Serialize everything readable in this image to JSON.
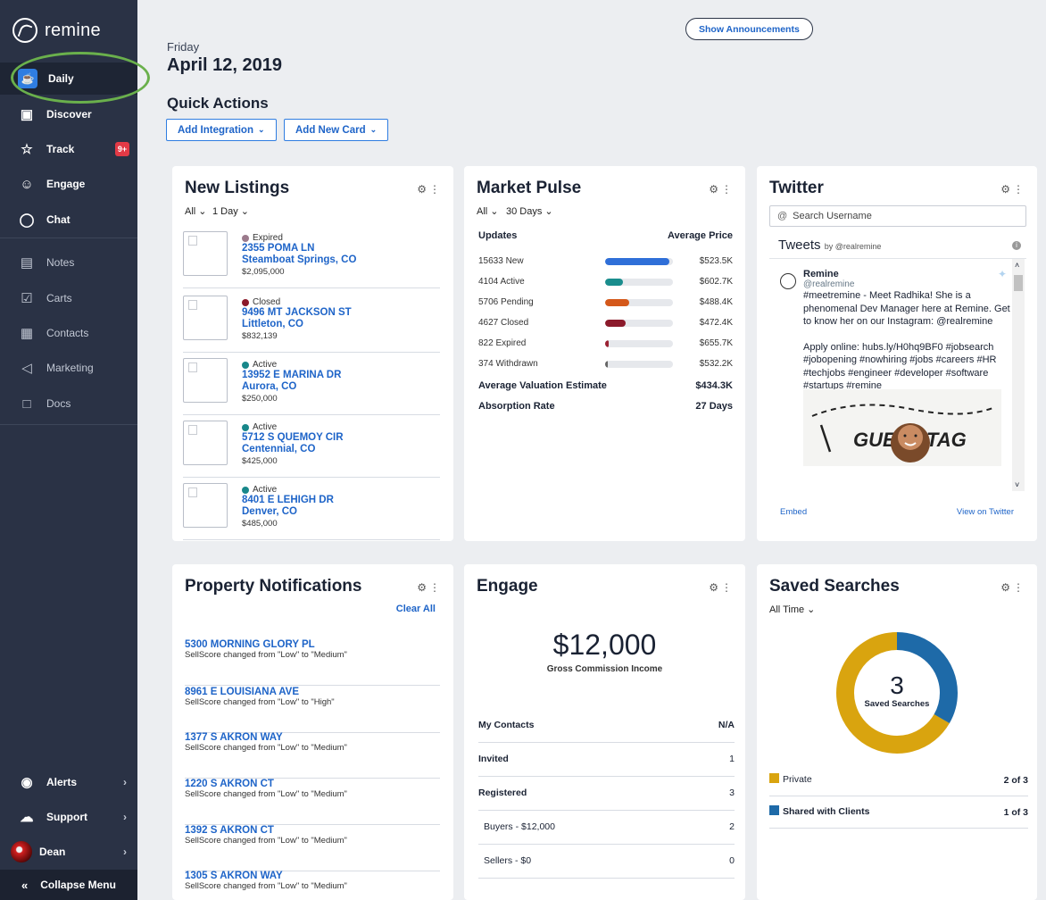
{
  "brand": {
    "name": "remine"
  },
  "sidebar": {
    "items": [
      {
        "label": "Daily",
        "icon": "daily-icon"
      },
      {
        "label": "Discover",
        "icon": "map-icon"
      },
      {
        "label": "Track",
        "icon": "star-icon",
        "badge": "9+"
      },
      {
        "label": "Engage",
        "icon": "users-icon"
      },
      {
        "label": "Chat",
        "icon": "chat-icon"
      },
      {
        "label": "Notes",
        "icon": "notes-icon"
      },
      {
        "label": "Carts",
        "icon": "cart-icon"
      },
      {
        "label": "Contacts",
        "icon": "contacts-icon"
      },
      {
        "label": "Marketing",
        "icon": "megaphone-icon"
      },
      {
        "label": "Docs",
        "icon": "doc-icon"
      }
    ],
    "bottom": [
      {
        "label": "Alerts",
        "icon": "bell-icon"
      },
      {
        "label": "Support",
        "icon": "headset-icon"
      },
      {
        "label": "Dean",
        "icon": "avatar"
      }
    ],
    "collapse_label": "Collapse Menu"
  },
  "header": {
    "announcements_label": "Show Announcements",
    "day": "Friday",
    "date": "April 12, 2019",
    "quick_actions_title": "Quick Actions",
    "add_integration": "Add Integration",
    "add_card": "Add New Card"
  },
  "new_listings": {
    "title": "New Listings",
    "filter_all": "All",
    "filter_range": "1 Day",
    "items": [
      {
        "status": "Expired",
        "status_color": "#9b7a8c",
        "address": "2355 POMA LN",
        "city": "Steamboat Springs, CO",
        "price": "$2,095,000"
      },
      {
        "status": "Closed",
        "status_color": "#8b1a2b",
        "address": "9496 MT JACKSON ST",
        "city": "Littleton, CO",
        "price": "$832,139"
      },
      {
        "status": "Active",
        "status_color": "#18878a",
        "address": "13952 E MARINA DR",
        "city": "Aurora, CO",
        "price": "$250,000"
      },
      {
        "status": "Active",
        "status_color": "#18878a",
        "address": "5712 S QUEMOY CIR",
        "city": "Centennial, CO",
        "price": "$425,000"
      },
      {
        "status": "Active",
        "status_color": "#18878a",
        "address": "8401 E LEHIGH DR",
        "city": "Denver, CO",
        "price": "$485,000"
      }
    ]
  },
  "market_pulse": {
    "title": "Market Pulse",
    "filter_all": "All",
    "filter_range": "30 Days",
    "col_updates": "Updates",
    "col_price": "Average Price",
    "rows": [
      {
        "label": "15633 New",
        "fill": 0.95,
        "color": "#2f6fd8",
        "price": "$523.5K"
      },
      {
        "label": "4104 Active",
        "fill": 0.26,
        "color": "#1a8d8d",
        "price": "$602.7K"
      },
      {
        "label": "5706 Pending",
        "fill": 0.36,
        "color": "#d4581a",
        "price": "$488.4K"
      },
      {
        "label": "4627 Closed",
        "fill": 0.3,
        "color": "#8b1a2b",
        "price": "$472.4K"
      },
      {
        "label": "822 Expired",
        "fill": 0.05,
        "color": "#9b2233",
        "price": "$655.7K"
      },
      {
        "label": "374 Withdrawn",
        "fill": 0.03,
        "color": "#666666",
        "price": "$532.2K"
      }
    ],
    "valuation_label": "Average Valuation Estimate",
    "valuation_value": "$434.3K",
    "absorption_label": "Absorption Rate",
    "absorption_value": "27 Days"
  },
  "twitter": {
    "title": "Twitter",
    "search_placeholder": "Search Username",
    "tweets_label": "Tweets",
    "by_label": "by @realremine",
    "tweet_name": "Remine",
    "tweet_handle": "@realremine",
    "tweet_text_1": "#meetremine - Meet Radhika! She is a phenomenal Dev Manager here at Remine. Get to know her on our Instagram: @realremine",
    "tweet_text_2": "Apply online: hubs.ly/H0hq9BF0 #jobsearch #jobopening #nowhiring #jobs #careers #HR #techjobs #engineer #developer #software #startups #remine",
    "image_text": "GUEST TAG",
    "embed": "Embed",
    "view_on": "View on Twitter"
  },
  "notifications": {
    "title": "Property Notifications",
    "clear_all": "Clear All",
    "items": [
      {
        "address": "5300 MORNING GLORY PL",
        "desc": "SellScore changed from \"Low\" to \"Medium\""
      },
      {
        "address": "8961 E LOUISIANA AVE",
        "desc": "SellScore changed from \"Low\" to \"High\""
      },
      {
        "address": "1377 S AKRON WAY",
        "desc": "SellScore changed from \"Low\" to \"Medium\""
      },
      {
        "address": "1220 S AKRON CT",
        "desc": "SellScore changed from \"Low\" to \"Medium\""
      },
      {
        "address": "1392 S AKRON CT",
        "desc": "SellScore changed from \"Low\" to \"Medium\""
      },
      {
        "address": "1305 S AKRON WAY",
        "desc": "SellScore changed from \"Low\" to \"Medium\""
      }
    ]
  },
  "engage": {
    "title": "Engage",
    "amount": "$12,000",
    "amount_label": "Gross Commission Income",
    "rows": [
      {
        "label": "My Contacts",
        "value": "N/A"
      },
      {
        "label": "Invited",
        "value": "1"
      },
      {
        "label": "Registered",
        "value": "3"
      },
      {
        "label": "Buyers - $12,000",
        "value": "2"
      },
      {
        "label": "Sellers - $0",
        "value": "0"
      }
    ]
  },
  "saved_searches": {
    "title": "Saved Searches",
    "filter": "All Time",
    "count": "3",
    "count_label": "Saved Searches",
    "segments": [
      {
        "label": "Private",
        "value": "2 of 3",
        "color": "#d9a40f",
        "fraction": 0.667
      },
      {
        "label": "Shared with Clients",
        "value": "1 of 3",
        "color": "#1e6aa8",
        "fraction": 0.333
      }
    ]
  }
}
